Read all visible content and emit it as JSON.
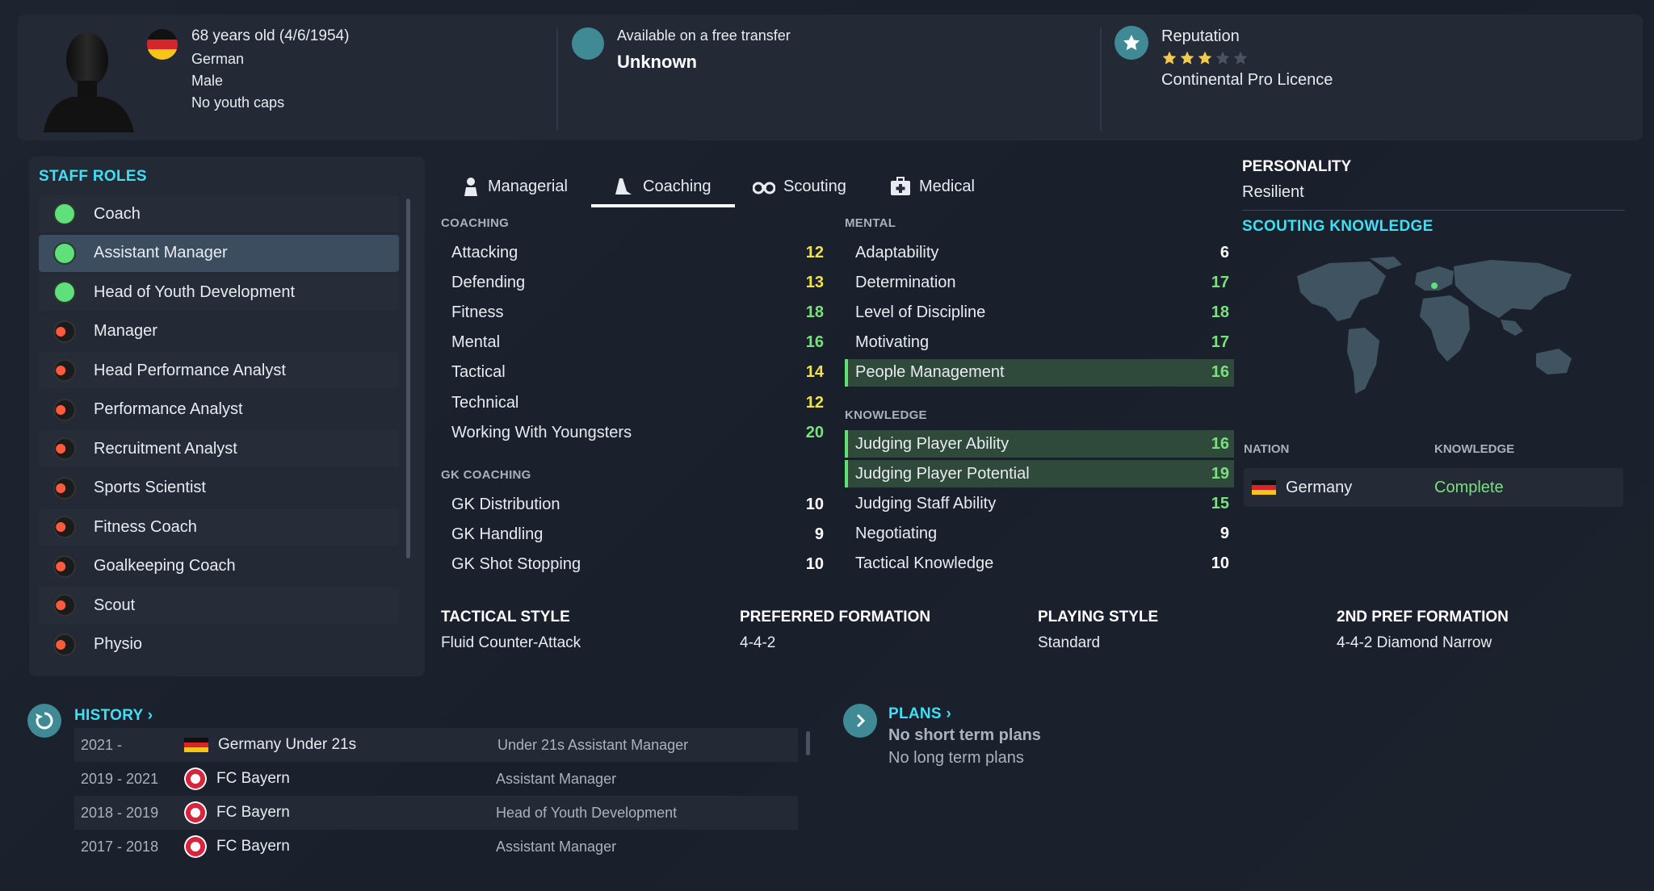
{
  "header": {
    "age_line": "68 years old (4/6/1954)",
    "nationality": "German",
    "gender": "Male",
    "youth_caps": "No youth caps",
    "transfer_label": "Available on a free transfer",
    "transfer_value": "Unknown",
    "reputation_label": "Reputation",
    "reputation_stars": 3,
    "reputation_max": 5,
    "licence": "Continental Pro Licence"
  },
  "staff_roles": {
    "title": "STAFF ROLES",
    "items": [
      {
        "label": "Coach",
        "status": "green"
      },
      {
        "label": "Assistant Manager",
        "status": "green"
      },
      {
        "label": "Head of Youth Development",
        "status": "green"
      },
      {
        "label": "Manager",
        "status": "red"
      },
      {
        "label": "Head Performance Analyst",
        "status": "red"
      },
      {
        "label": "Performance Analyst",
        "status": "red"
      },
      {
        "label": "Recruitment Analyst",
        "status": "red"
      },
      {
        "label": "Sports Scientist",
        "status": "red"
      },
      {
        "label": "Fitness Coach",
        "status": "red"
      },
      {
        "label": "Goalkeeping Coach",
        "status": "red"
      },
      {
        "label": "Scout",
        "status": "red"
      },
      {
        "label": "Physio",
        "status": "red"
      }
    ]
  },
  "tabs": [
    {
      "label": "Managerial",
      "icon": "person-icon"
    },
    {
      "label": "Coaching",
      "icon": "cone-icon"
    },
    {
      "label": "Scouting",
      "icon": "binoculars-icon"
    },
    {
      "label": "Medical",
      "icon": "medical-kit-icon"
    }
  ],
  "coaching": {
    "title": "COACHING",
    "attrs": [
      {
        "name": "Attacking",
        "value": "12"
      },
      {
        "name": "Defending",
        "value": "13"
      },
      {
        "name": "Fitness",
        "value": "18"
      },
      {
        "name": "Mental",
        "value": "16"
      },
      {
        "name": "Tactical",
        "value": "14"
      },
      {
        "name": "Technical",
        "value": "12"
      },
      {
        "name": "Working With Youngsters",
        "value": "20"
      }
    ]
  },
  "gk_coaching": {
    "title": "GK COACHING",
    "attrs": [
      {
        "name": "GK Distribution",
        "value": "10"
      },
      {
        "name": "GK Handling",
        "value": "9"
      },
      {
        "name": "GK Shot Stopping",
        "value": "10"
      }
    ]
  },
  "mental": {
    "title": "MENTAL",
    "attrs": [
      {
        "name": "Adaptability",
        "value": "6"
      },
      {
        "name": "Determination",
        "value": "17"
      },
      {
        "name": "Level of Discipline",
        "value": "18"
      },
      {
        "name": "Motivating",
        "value": "17"
      },
      {
        "name": "People Management",
        "value": "16"
      }
    ]
  },
  "knowledge": {
    "title": "KNOWLEDGE",
    "attrs": [
      {
        "name": "Judging Player Ability",
        "value": "16"
      },
      {
        "name": "Judging Player Potential",
        "value": "19"
      },
      {
        "name": "Judging Staff Ability",
        "value": "15"
      },
      {
        "name": "Negotiating",
        "value": "9"
      },
      {
        "name": "Tactical Knowledge",
        "value": "10"
      }
    ]
  },
  "styles": [
    {
      "title": "TACTICAL STYLE",
      "value": "Fluid Counter-Attack"
    },
    {
      "title": "PREFERRED FORMATION",
      "value": "4-4-2"
    },
    {
      "title": "PLAYING STYLE",
      "value": "Standard"
    },
    {
      "title": "2ND PREF FORMATION",
      "value": "4-4-2 Diamond Narrow"
    }
  ],
  "personality": {
    "title": "PERSONALITY",
    "value": "Resilient"
  },
  "scouting_knowledge": {
    "title": "SCOUTING KNOWLEDGE",
    "nation_header": "NATION",
    "knowledge_header": "KNOWLEDGE",
    "rows": [
      {
        "nation": "Germany",
        "knowledge": "Complete"
      }
    ]
  },
  "history": {
    "title": "HISTORY",
    "rows": [
      {
        "years": "2021 -",
        "team": "Germany Under 21s",
        "role": "Under 21s Assistant Manager",
        "badge": "germany-flag"
      },
      {
        "years": "2019 - 2021",
        "team": "FC Bayern",
        "role": "Assistant Manager",
        "badge": "fc-bayern-badge"
      },
      {
        "years": "2018 - 2019",
        "team": "FC Bayern",
        "role": "Head of Youth Development",
        "badge": "fc-bayern-badge"
      },
      {
        "years": "2017 - 2018",
        "team": "FC Bayern",
        "role": "Assistant Manager",
        "badge": "fc-bayern-badge"
      }
    ]
  },
  "plans": {
    "title": "PLANS",
    "short_term": "No short term plans",
    "long_term": "No long term plans"
  },
  "colors": {
    "accent_cyan": "#3ee0f5",
    "value_yellow": "#f2e24a",
    "value_green": "#7ae07d",
    "status_green": "#5fe07a",
    "teal": "#3f8a94"
  }
}
